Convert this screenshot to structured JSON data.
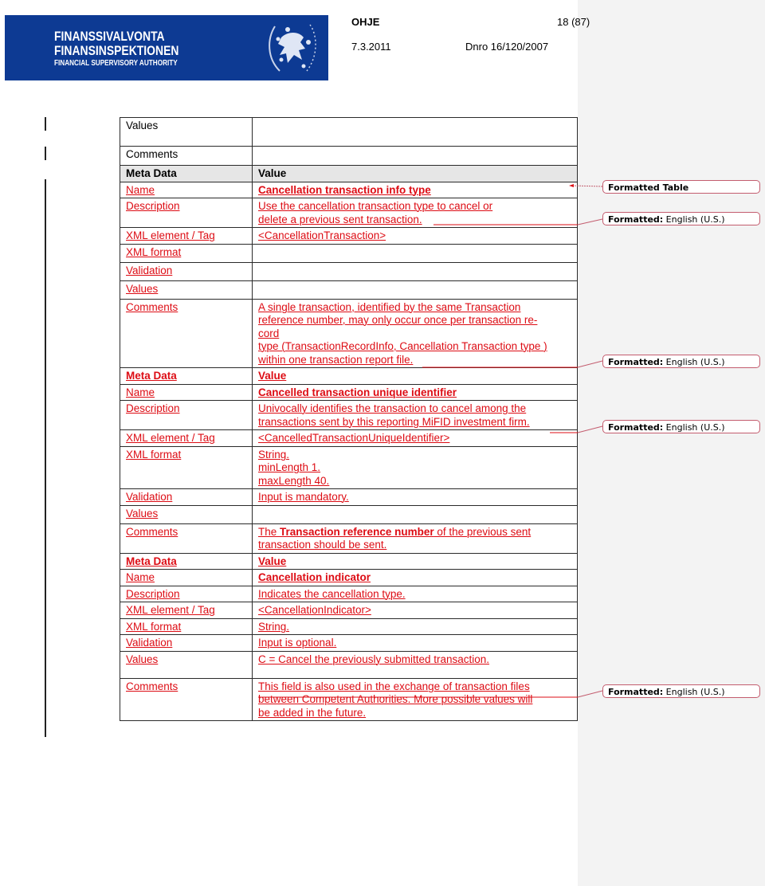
{
  "header": {
    "logo": {
      "line1": "FINANSSIVALVONTA",
      "line2": "FINANSINSPEKTIONEN",
      "line3": "FINANCIAL SUPERVISORY AUTHORITY",
      "brand_color": "#0d3a93"
    },
    "doc_type": "OHJE",
    "page": "18 (87)",
    "date": "7.3.2011",
    "dnro": "Dnro 16/120/2007"
  },
  "table": {
    "top_rows": [
      {
        "key": "Values",
        "value": ""
      },
      {
        "key": "Comments",
        "value": ""
      }
    ],
    "header": {
      "key": "Meta Data",
      "value": "Value"
    },
    "blocks": [
      {
        "rows": [
          {
            "key": "Name",
            "value": "Cancellation transaction info type"
          },
          {
            "key": "Description",
            "value_lines": [
              "Use the cancellation transaction type to cancel or",
              "delete a previous sent transaction."
            ]
          },
          {
            "key": "XML element / Tag",
            "value": "<CancellationTransaction>"
          },
          {
            "key": "XML format",
            "value": ""
          },
          {
            "key": "Validation",
            "value": ""
          },
          {
            "key": "Values",
            "value": ""
          },
          {
            "key": "Comments",
            "value_lines": [
              "A single transaction, identified by the same Transaction",
              "reference number, may only occur once per transaction re-",
              "cord",
              "type (TransactionRecordInfo, Cancellation Transaction type )",
              "within one transaction report file."
            ]
          }
        ]
      },
      {
        "header": {
          "key": "Meta Data",
          "value": "Value"
        },
        "rows": [
          {
            "key": "Name",
            "value": "Cancelled transaction unique identifier"
          },
          {
            "key": "Description",
            "value_lines": [
              "Univocally identifies the transaction to cancel among the",
              "transactions sent by this reporting MiFID investment firm."
            ]
          },
          {
            "key": "XML element / Tag",
            "value": "<CancelledTransactionUniqueIdentifier>"
          },
          {
            "key": "XML format",
            "value_lines": [
              "String.",
              "minLength 1.",
              "maxLength 40."
            ]
          },
          {
            "key": "Validation",
            "value": "Input is mandatory."
          },
          {
            "key": "Values",
            "value": ""
          },
          {
            "key": "Comments",
            "value_parts": {
              "pre": "The ",
              "bold": "Transaction reference number",
              "post": " of the previous sent",
              "line2": "transaction should be sent."
            }
          }
        ]
      },
      {
        "header": {
          "key": "Meta Data",
          "value": "Value"
        },
        "rows": [
          {
            "key": "Name",
            "value": "Cancellation indicator"
          },
          {
            "key": "Description",
            "value": "Indicates the cancellation type."
          },
          {
            "key": "XML element / Tag",
            "value": "<CancellationIndicator>"
          },
          {
            "key": "XML format",
            "value": "String."
          },
          {
            "key": "Validation",
            "value": "Input is optional."
          },
          {
            "key": "Values",
            "value": "C =  Cancel the previously submitted transaction."
          },
          {
            "key": "Comments",
            "value_lines": [
              "This field is also used in the exchange of transaction files",
              "between Competent Authorities. More possible values will",
              "be added in the future."
            ]
          }
        ]
      }
    ]
  },
  "markup": {
    "balloons": [
      {
        "label": "Formatted Table",
        "detail": ""
      },
      {
        "label": "Formatted:",
        "detail": " English (U.S.)"
      },
      {
        "label": "Formatted:",
        "detail": " English (U.S.)"
      },
      {
        "label": "Formatted:",
        "detail": " English (U.S.)"
      },
      {
        "label": "Formatted:",
        "detail": " English (U.S.)"
      }
    ],
    "revision_color": "#dd0c14",
    "balloon_border_color": "#c35c6e"
  }
}
